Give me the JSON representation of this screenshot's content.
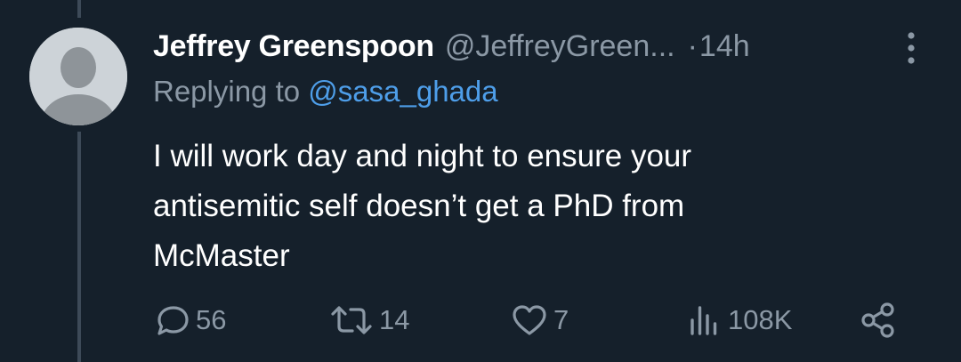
{
  "tweet": {
    "author": {
      "display_name": "Jeffrey Greenspoon",
      "handle": "@JeffreyGreen...",
      "avatar_icon": "default-avatar-icon"
    },
    "separator": "·",
    "time": "14h",
    "replying_prefix": "Replying to",
    "replying_handle": "@sasa_ghada",
    "text_lines": [
      "I will work day and night to ensure your",
      "antisemitic self doesn’t get a PhD from",
      "McMaster"
    ],
    "stats": {
      "replies": "56",
      "retweets": "14",
      "likes": "7",
      "views": "108K"
    }
  },
  "colors": {
    "background": "#15202b",
    "primary_text": "#ffffff",
    "secondary_text": "#8b98a5",
    "link": "#4e9ee9",
    "thread_line": "#3d4a58",
    "avatar_bg": "#cdd3d8",
    "avatar_figure": "#8e9499"
  },
  "icons": [
    "more-options-icon",
    "reply-icon",
    "retweet-icon",
    "like-icon",
    "views-icon",
    "share-icon"
  ]
}
